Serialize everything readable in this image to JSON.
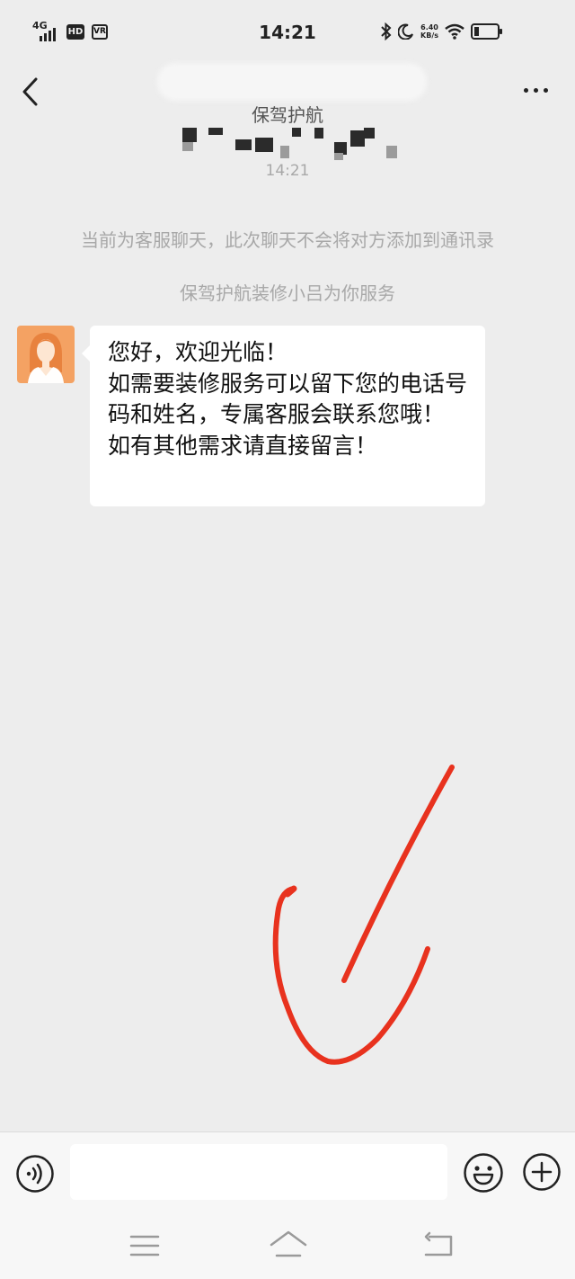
{
  "status_bar": {
    "network": "4G",
    "hd_badge": "HD",
    "vr_badge": "VR",
    "time": "14:21",
    "speed_value": "6.40",
    "speed_unit": "KB/s",
    "battery_level": 0.2
  },
  "header": {
    "subtitle": "保驾护航"
  },
  "chat": {
    "time_label": "14:21",
    "system_notice": "当前为客服聊天，此次聊天不会将对方添加到通讯录",
    "service_notice": "保驾护航装修小吕为你服务",
    "messages": [
      {
        "sender": "customer-service",
        "text": "您好，欢迎光临！\n如需要装修服务可以留下您的电话号码和姓名，专属客服会联系您哦！\n如有其他需求请直接留言！"
      }
    ]
  },
  "input_bar": {
    "input_value": "",
    "placeholder": ""
  },
  "colors": {
    "background": "#ededed",
    "bubble": "#ffffff",
    "annotation": "#e8321e",
    "avatar_bg": "#f4a263"
  }
}
